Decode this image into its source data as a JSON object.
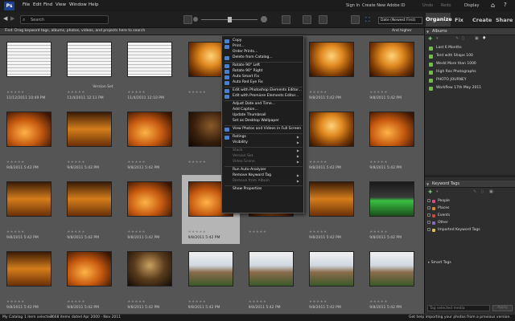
{
  "menubar": {
    "logo": "Ps",
    "items": [
      "File",
      "Edit",
      "Find",
      "View",
      "Window",
      "Help"
    ],
    "signin": "Sign In",
    "create_id": "Create New Adobe ID",
    "undo": "Undo",
    "redo": "Redo",
    "display": "Display"
  },
  "toolbar": {
    "search_placeholder": "Search",
    "sort": "Date (Newest First)",
    "tabs": [
      "Organize",
      "Fix",
      "Create",
      "Share"
    ]
  },
  "findbar": {
    "text": "Find: Drag keyword tags, albums, photos, videos, and projects here to search",
    "dropdown": "And higher"
  },
  "grid": {
    "rows": [
      [
        {
          "date": "11/12/2011 10:49 PM",
          "style": "paper"
        },
        {
          "date": "11/4/2011 12:11 PM",
          "style": "paper",
          "extra": "Version Set"
        },
        {
          "date": "11/4/2011 12:10 PM",
          "style": "paper"
        },
        {
          "date": "",
          "style": "warm1"
        },
        {
          "date": "",
          "style": "paper"
        },
        {
          "date": "9/8/2011 5:42 PM",
          "style": "warm1"
        },
        {
          "date": "9/8/2011 5:42 PM",
          "style": "warm1"
        }
      ],
      [
        {
          "date": "9/8/2011 5:42 PM",
          "style": "warm2"
        },
        {
          "date": "9/8/2011 5:42 PM",
          "style": "warm3"
        },
        {
          "date": "9/8/2011 5:42 PM",
          "style": "warm2"
        },
        {
          "date": "",
          "style": "dark"
        },
        {
          "date": "",
          "style": "warm1"
        },
        {
          "date": "9/8/2011 5:42 PM",
          "style": "warm1"
        },
        {
          "date": "9/8/2011 5:42 PM",
          "style": "warm2"
        }
      ],
      [
        {
          "date": "9/8/2011 5:42 PM",
          "style": "warm3"
        },
        {
          "date": "9/8/2011 5:42 PM",
          "style": "warm3"
        },
        {
          "date": "9/8/2011 5:42 PM",
          "style": "warm2"
        },
        {
          "date": "9/8/2011 5:42 PM",
          "style": "warm2",
          "selected": true
        },
        {
          "date": "",
          "style": "warm1"
        },
        {
          "date": "9/8/2011 5:42 PM",
          "style": "warm3"
        },
        {
          "date": "9/8/2011 5:42 PM",
          "style": "green"
        }
      ],
      [
        {
          "date": "9/8/2011 5:42 PM",
          "style": "warm3"
        },
        {
          "date": "9/8/2011 5:42 PM",
          "style": "warm2"
        },
        {
          "date": "9/8/2011 5:42 PM",
          "style": "night"
        },
        {
          "date": "9/8/2011 5:42 PM",
          "style": "day"
        },
        {
          "date": "9/8/2011 5:42 PM",
          "style": "day"
        },
        {
          "date": "9/8/2011 5:42 PM",
          "style": "day"
        },
        {
          "date": "9/8/2011 5:42 PM",
          "style": "day"
        }
      ]
    ]
  },
  "context_menu": {
    "items": [
      {
        "label": "Copy",
        "icon": true
      },
      {
        "label": "Print...",
        "icon": true
      },
      {
        "label": "Order Prints...",
        "icon": false
      },
      {
        "label": "Delete from Catalog...",
        "icon": true
      },
      {
        "sep": true
      },
      {
        "label": "Rotate 90° Left",
        "icon": true
      },
      {
        "label": "Rotate 90° Right",
        "icon": true
      },
      {
        "label": "Auto Smart Fix",
        "icon": true
      },
      {
        "label": "Auto Red Eye Fix",
        "icon": true
      },
      {
        "sep": true
      },
      {
        "label": "Edit with Photoshop Elements Editor...",
        "icon": true
      },
      {
        "label": "Edit with Premiere Elements Editor...",
        "icon": true
      },
      {
        "sep": true
      },
      {
        "label": "Adjust Date and Time...",
        "icon": false
      },
      {
        "label": "Add Caption...",
        "icon": false
      },
      {
        "label": "Update Thumbnail",
        "icon": false
      },
      {
        "label": "Set as Desktop Wallpaper",
        "icon": false
      },
      {
        "sep": true
      },
      {
        "label": "View Photos and Videos in Full Screen",
        "icon": true
      },
      {
        "sep": true
      },
      {
        "label": "Ratings",
        "icon": true,
        "sub": true
      },
      {
        "label": "Visibility",
        "icon": false,
        "sub": true
      },
      {
        "sep": true
      },
      {
        "label": "Stack",
        "icon": false,
        "sub": true,
        "disabled": true
      },
      {
        "label": "Version Set",
        "icon": false,
        "sub": true,
        "disabled": true
      },
      {
        "label": "Video Scene",
        "icon": false,
        "sub": true,
        "disabled": true
      },
      {
        "sep": true
      },
      {
        "label": "Run Auto-Analyzer",
        "icon": false
      },
      {
        "label": "Remove Keyword Tag",
        "icon": false,
        "sub": true
      },
      {
        "label": "Remove from Album",
        "icon": false,
        "sub": true,
        "disabled": true
      },
      {
        "sep": true
      },
      {
        "label": "Show Properties",
        "icon": false
      }
    ]
  },
  "right_panel": {
    "albums_title": "Albums",
    "albums": [
      "Last 6 Months",
      "Tent with Shape 100",
      "Wedd More than 1000",
      "High Res Photographs",
      "PHOTO JOURNEY",
      "Workflow 17th May 2011"
    ],
    "tags_title": "Keyword Tags",
    "tags": [
      {
        "label": "People",
        "color": "#d94a8a"
      },
      {
        "label": "Places",
        "color": "#d98a2a"
      },
      {
        "label": "Events",
        "color": "#c94a3a"
      },
      {
        "label": "Other",
        "color": "#8a6ac0"
      },
      {
        "label": "Imported Keyword Tags",
        "color": "#d9c04a"
      }
    ],
    "smart_tags": "Smart Tags",
    "tag_selected": "Tag selected media",
    "apply": "Apply"
  },
  "statusbar": {
    "catalog": "My Catalog",
    "selected": "1 item selected",
    "items": "3668 items dated Apr 2000 - Nov 2011",
    "help": "Get help importing your photos from a previous version."
  }
}
